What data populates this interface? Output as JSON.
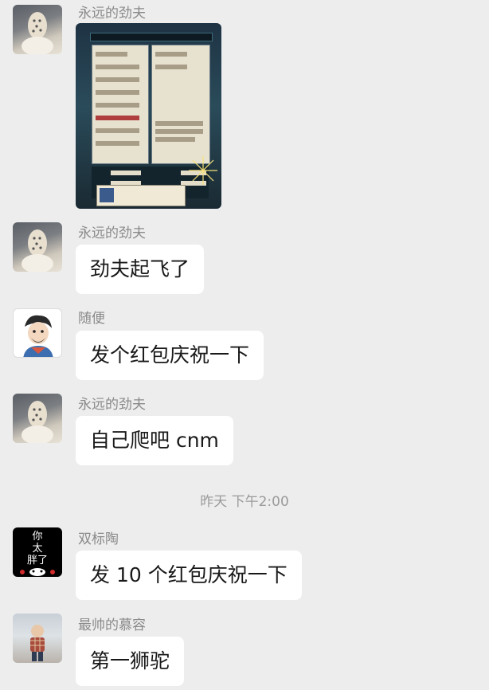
{
  "messages": [
    {
      "sender": "永远的劲夫",
      "avatar": "cat-hat-avatar",
      "kind": "image",
      "image_desc": "game-screenshot"
    },
    {
      "sender": "永远的劲夫",
      "avatar": "cat-hat-avatar",
      "kind": "text",
      "text": "劲夫起飞了"
    },
    {
      "sender": "随便",
      "avatar": "cartoon-avatar",
      "kind": "text",
      "text": "发个红包庆祝一下"
    },
    {
      "sender": "永远的劲夫",
      "avatar": "cat-hat-avatar",
      "kind": "text",
      "text": "自己爬吧 cnm"
    },
    {
      "kind": "time",
      "text": "昨天 下午2:00"
    },
    {
      "sender": "双标陶",
      "avatar": "bear-meme-avatar",
      "avatar_text": "你太胖了",
      "kind": "text",
      "text": "发 10 个红包庆祝一下"
    },
    {
      "sender": "最帅的慕容",
      "avatar": "kid-photo-avatar",
      "kind": "text",
      "text": "第一狮驼"
    }
  ]
}
